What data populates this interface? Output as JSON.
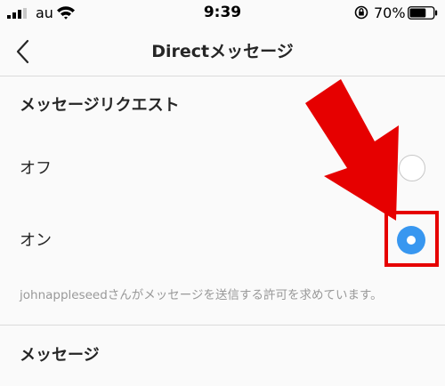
{
  "status_bar": {
    "carrier": "au",
    "time": "9:39",
    "battery_percent": "70%",
    "battery_level": 0.7,
    "icons": [
      "signal-icon",
      "wifi-icon",
      "orientation-lock-icon",
      "battery-icon"
    ]
  },
  "nav": {
    "title": "Directメッセージ",
    "back_icon": "chevron-left-icon"
  },
  "requests_section": {
    "title": "メッセージリクエスト",
    "options": [
      {
        "label": "オフ",
        "selected": false
      },
      {
        "label": "オン",
        "selected": true
      }
    ],
    "helper_text": "johnappleseedさんがメッセージを送信する許可を求めています。"
  },
  "messages_section": {
    "title": "メッセージ"
  },
  "colors": {
    "accent": "#3897f0",
    "annotation": "#e60000",
    "background": "#fafafa",
    "divider": "#dbdbdb"
  },
  "annotation": {
    "arrow_icon": "red-arrow-icon",
    "highlight": "selected-option-highlight"
  }
}
